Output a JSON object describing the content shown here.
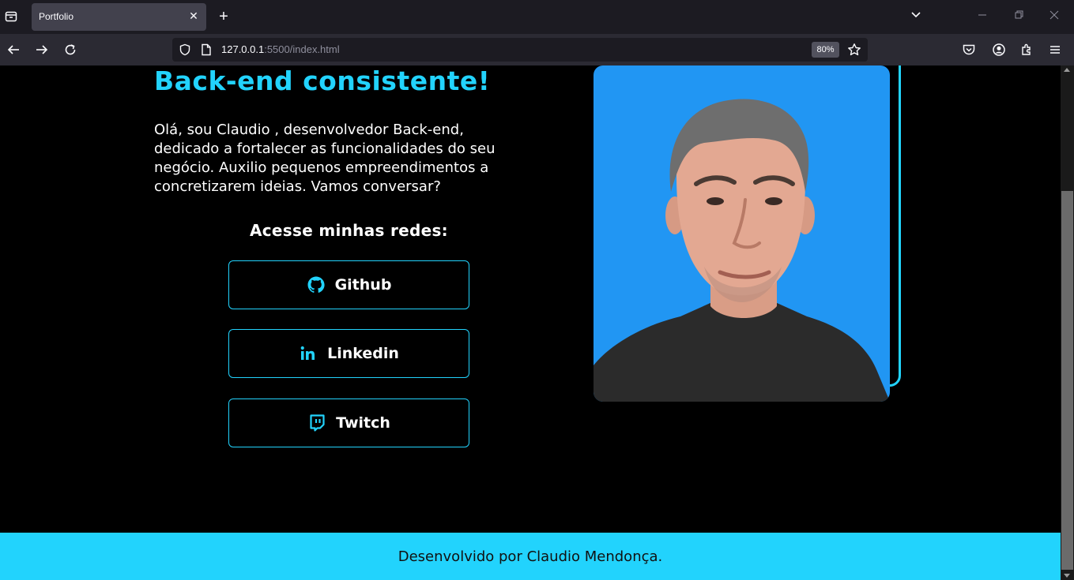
{
  "browser": {
    "tab_title": "Portfolio",
    "tab_close": "✕",
    "new_tab": "+",
    "url_host": "127.0.0.1",
    "url_rest": ":5500/index.html",
    "zoom": "80%"
  },
  "hero": {
    "title": "Back-end consistente!",
    "text": "Olá, sou Claudio , desenvolvedor Back-end, dedicado a fortalecer as funcionalidades do seu negócio. Auxilio pequenos empreendimentos a concretizarem ideias. Vamos conversar?"
  },
  "networks": {
    "title": "Acesse minhas redes:",
    "items": [
      {
        "label": "Github",
        "icon": "github-icon"
      },
      {
        "label": "Linkedin",
        "icon": "linkedin-icon"
      },
      {
        "label": "Twitch",
        "icon": "twitch-icon"
      }
    ]
  },
  "footer": {
    "text": "Desenvolvido por Claudio Mendonça."
  },
  "colors": {
    "accent": "#22d3fd",
    "photo_bg": "#2196f3",
    "background": "#000000"
  }
}
